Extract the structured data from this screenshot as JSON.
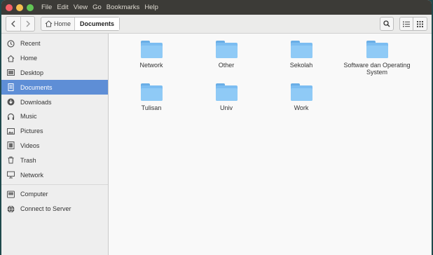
{
  "menubar": {
    "items": [
      "File",
      "Edit",
      "View",
      "Go",
      "Bookmarks",
      "Help"
    ]
  },
  "toolbar": {
    "back_icon": "chevron-left-icon",
    "forward_icon": "chevron-right-icon",
    "breadcrumbs": [
      "Home",
      "Documents"
    ],
    "search_icon": "search-icon",
    "list_view_icon": "list-view-icon",
    "grid_view_icon": "grid-view-icon"
  },
  "sidebar": {
    "places": [
      {
        "label": "Recent",
        "icon": "clock-icon"
      },
      {
        "label": "Home",
        "icon": "home-icon"
      },
      {
        "label": "Desktop",
        "icon": "desktop-icon"
      },
      {
        "label": "Documents",
        "icon": "documents-icon",
        "active": true
      },
      {
        "label": "Downloads",
        "icon": "download-icon"
      },
      {
        "label": "Music",
        "icon": "music-icon"
      },
      {
        "label": "Pictures",
        "icon": "pictures-icon"
      },
      {
        "label": "Videos",
        "icon": "videos-icon"
      },
      {
        "label": "Trash",
        "icon": "trash-icon"
      },
      {
        "label": "Network",
        "icon": "network-icon"
      }
    ],
    "devices": [
      {
        "label": "Computer",
        "icon": "computer-icon"
      },
      {
        "label": "Connect to Server",
        "icon": "server-icon"
      }
    ]
  },
  "folders": [
    {
      "name": "Network"
    },
    {
      "name": "Other"
    },
    {
      "name": "Sekolah"
    },
    {
      "name": "Software dan Operating System"
    },
    {
      "name": "Tulisan"
    },
    {
      "name": "Univ"
    },
    {
      "name": "Work"
    }
  ],
  "colors": {
    "accent": "#5e8ed6",
    "folder": "#7cbdf1",
    "titlebar": "#3c3b37"
  }
}
